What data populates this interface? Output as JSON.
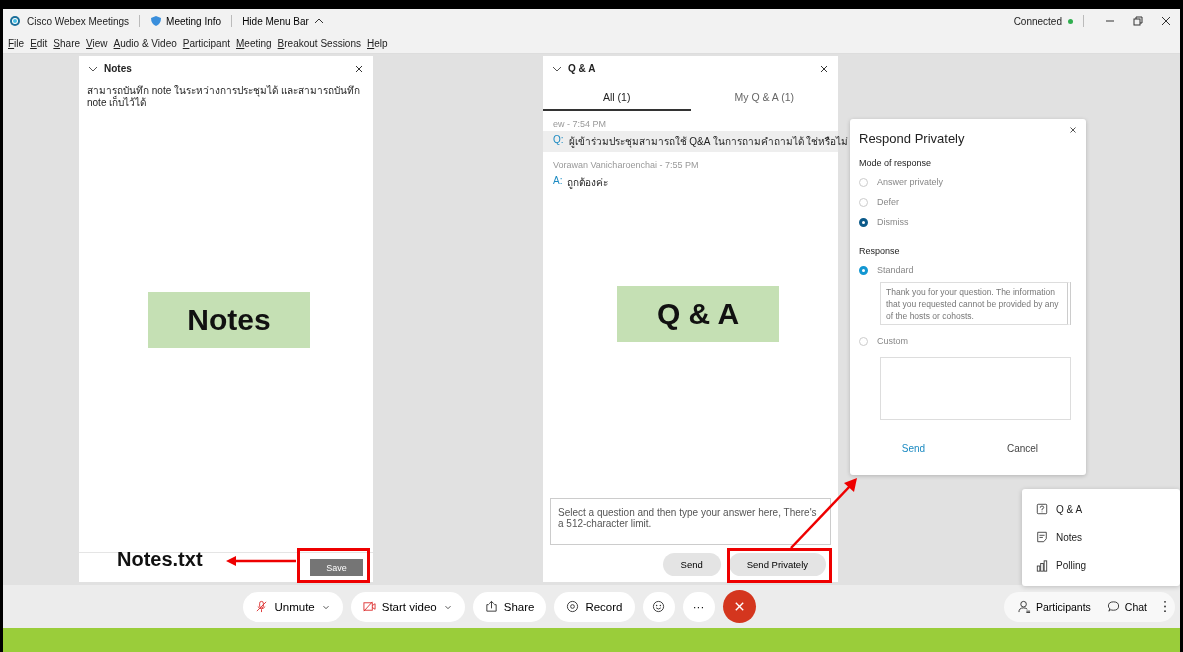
{
  "title_bar": {
    "app_name": "Cisco Webex Meetings",
    "meeting_info": "Meeting Info",
    "hide_menu": "Hide Menu Bar",
    "status": "Connected"
  },
  "menu_bar": [
    "File",
    "Edit",
    "Share",
    "View",
    "Audio & Video",
    "Participant",
    "Meeting",
    "Breakout Sessions",
    "Help"
  ],
  "notes_panel": {
    "title": "Notes",
    "text": "สามารถบันทึก note ในระหว่างการประชุมได้ และสามารถบันทึก note เก็บไว้ได้",
    "save": "Save"
  },
  "qa_panel": {
    "title": "Q & A",
    "tabs": [
      {
        "label": "All (1)",
        "selected": true
      },
      {
        "label": "My Q & A (1)",
        "selected": false
      }
    ],
    "entries": [
      {
        "meta": "ew - 7:54 PM",
        "prefix": "Q:",
        "text": "ผู้เข้าร่วมประชุมสามารถใช้ Q&A ในการถามคำถามได้ ใช่หรือไม่",
        "selected": true
      },
      {
        "meta": "Vorawan Vanicharoenchai - 7:55 PM",
        "prefix": "A:",
        "text": "ถูกต้องค่ะ",
        "selected": false
      }
    ],
    "answer_placeholder": "Select a question and then type your answer here, There's a 512-character limit.",
    "buttons": [
      "Send",
      "Send Privately"
    ]
  },
  "respond_dialog": {
    "title": "Respond Privately",
    "mode_label": "Mode of response",
    "modes": [
      {
        "label": "Answer privately",
        "selected": false
      },
      {
        "label": "Defer",
        "selected": false
      },
      {
        "label": "Dismiss",
        "selected": true
      }
    ],
    "response_label": "Response",
    "responses": [
      {
        "label": "Standard",
        "selected": true,
        "text": "Thank you for your question. The information that you requested cannot be provided by any of the hosts or cohosts."
      },
      {
        "label": "Custom",
        "selected": false
      }
    ],
    "send": "Send",
    "cancel": "Cancel"
  },
  "controls": [
    {
      "kind": "mute",
      "label": "Unmute",
      "dropdown": true
    },
    {
      "kind": "video",
      "label": "Start video",
      "dropdown": true
    },
    {
      "kind": "share",
      "label": "Share",
      "dropdown": false
    },
    {
      "kind": "record",
      "label": "Record",
      "dropdown": false
    },
    {
      "kind": "reactions"
    },
    {
      "kind": "more",
      "label": "···"
    },
    {
      "kind": "end"
    }
  ],
  "side_buttons": [
    {
      "kind": "participants",
      "label": "Participants"
    },
    {
      "kind": "chat",
      "label": "Chat"
    }
  ],
  "more_menu": [
    {
      "kind": "qa",
      "label": "Q & A"
    },
    {
      "kind": "notes",
      "label": "Notes"
    },
    {
      "kind": "polling",
      "label": "Polling"
    }
  ],
  "annotations": {
    "notes_label": "Notes",
    "qa_label": "Q & A",
    "file_label": "Notes.txt"
  }
}
